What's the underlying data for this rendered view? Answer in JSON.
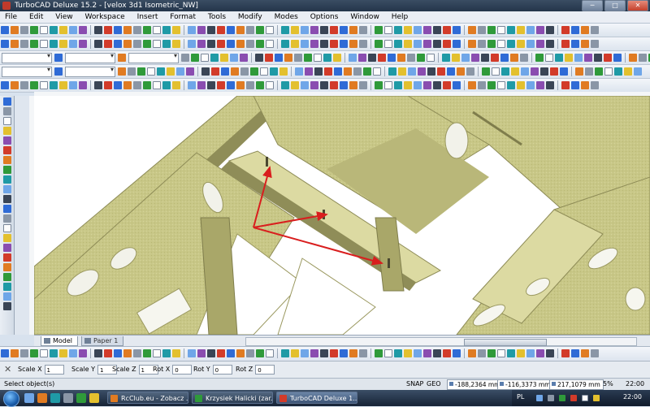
{
  "window": {
    "title": "TurboCAD Deluxe 15.2 - [velox 3d1 Isometric_NW]",
    "minimize_label": "─",
    "maximize_label": "□",
    "close_label": "✕"
  },
  "menu": {
    "items": [
      "File",
      "Edit",
      "View",
      "Workspace",
      "Insert",
      "Format",
      "Tools",
      "Modify",
      "Modes",
      "Options",
      "Window",
      "Help"
    ]
  },
  "drawing": {
    "model_color": "#c9c98a",
    "shadow_color": "#7f7d4c",
    "highlight_color": "#e6e4b2",
    "arrow_color": "#d91e1e"
  },
  "tabs": [
    {
      "label": "Model"
    },
    {
      "label": "Paper 1"
    }
  ],
  "inspector": {
    "close_icon": "✕",
    "fields": [
      {
        "label": "Scale X",
        "value": "1"
      },
      {
        "label": "Scale Y",
        "value": "1"
      },
      {
        "label": "Scale Z",
        "value": "1"
      },
      {
        "label": "Rot X",
        "value": "0"
      },
      {
        "label": "Rot Y",
        "value": "0"
      },
      {
        "label": "Rot Z",
        "value": "0"
      }
    ]
  },
  "status": {
    "prompt": "Select object(s)",
    "snap": "SNAP",
    "geo": "GEO",
    "x": "-188,2364 mm",
    "y": "-116,3373 mm",
    "z": "217,1079 mm",
    "zoom": "5%",
    "time": "22:00"
  },
  "taskbar": {
    "buttons": [
      {
        "label": "RcClub.eu - Zobacz ..."
      },
      {
        "label": "Krzysiek Halicki (zar..."
      },
      {
        "label": "TurboCAD Deluxe 1..."
      }
    ],
    "language": "PL",
    "clock": "22:00"
  }
}
